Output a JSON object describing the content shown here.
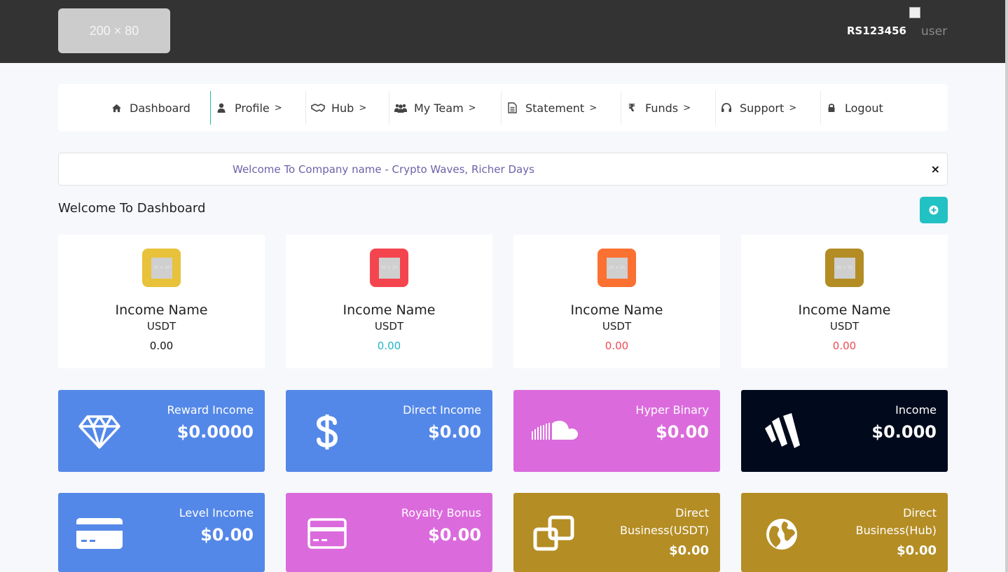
{
  "header": {
    "logo_text": "200 × 80",
    "user_id": "RS123456",
    "avatar_alt": "user"
  },
  "nav": [
    {
      "label": "Dashboard",
      "icon": "home-icon",
      "chevron": ""
    },
    {
      "label": "Profile",
      "icon": "user-icon",
      "chevron": ">"
    },
    {
      "label": "Hub",
      "icon": "handshake-icon",
      "chevron": ">"
    },
    {
      "label": "My Team",
      "icon": "users-icon",
      "chevron": ">"
    },
    {
      "label": "Statement",
      "icon": "document-icon",
      "chevron": ">"
    },
    {
      "label": "Funds",
      "icon": "rupee-icon",
      "chevron": ">"
    },
    {
      "label": "Support",
      "icon": "headset-icon",
      "chevron": ">"
    },
    {
      "label": "Logout",
      "icon": "lock-icon",
      "chevron": ""
    }
  ],
  "marquee": {
    "text": "Welcome To Company name - Crypto Waves, Richer Days",
    "close": "×"
  },
  "page_title": "Welcome To Dashboard",
  "income_cards": [
    {
      "name": "Income Name",
      "currency": "USDT",
      "value": "0.00",
      "placeholder": "30 × 30",
      "accent": "#e8c23a",
      "value_color": "#111111"
    },
    {
      "name": "Income Name",
      "currency": "USDT",
      "value": "0.00",
      "placeholder": "30 × 30",
      "accent": "#f4454f",
      "value_color": "#22b5c7"
    },
    {
      "name": "Income Name",
      "currency": "USDT",
      "value": "0.00",
      "placeholder": "30 × 30",
      "accent": "#fb7131",
      "value_color": "#ef4b55"
    },
    {
      "name": "Income Name",
      "currency": "USDT",
      "value": "0.00",
      "placeholder": "30 × 30",
      "accent": "#b38c24",
      "value_color": "#ef4b55"
    }
  ],
  "stat_cards": [
    {
      "label": "Reward Income",
      "amount": "$0.0000",
      "icon": "diamond-icon",
      "color": "#5488e8"
    },
    {
      "label": "Direct Income",
      "amount": "$0.00",
      "icon": "dollar-icon",
      "color": "#5488e8"
    },
    {
      "label": "Hyper Binary",
      "amount": "$0.00",
      "icon": "soundcloud-icon",
      "color": "#db6bdc"
    },
    {
      "label": "Income",
      "amount": "$0.000",
      "icon": "w-logo-icon",
      "color": "#000a1c"
    },
    {
      "label": "Level Income",
      "amount": "$0.00",
      "icon": "credit-card-icon",
      "color": "#5488e8"
    },
    {
      "label": "Royalty Bonus",
      "amount": "$0.00",
      "icon": "credit-card-outline-icon",
      "color": "#db6bdc"
    },
    {
      "label": "Direct Business(USDT)",
      "amount": "$0.00",
      "icon": "clone-icon",
      "color": "#b48d24"
    },
    {
      "label": "Direct Business(Hub)",
      "amount": "$0.00",
      "icon": "globe-icon",
      "color": "#b48d24"
    }
  ]
}
